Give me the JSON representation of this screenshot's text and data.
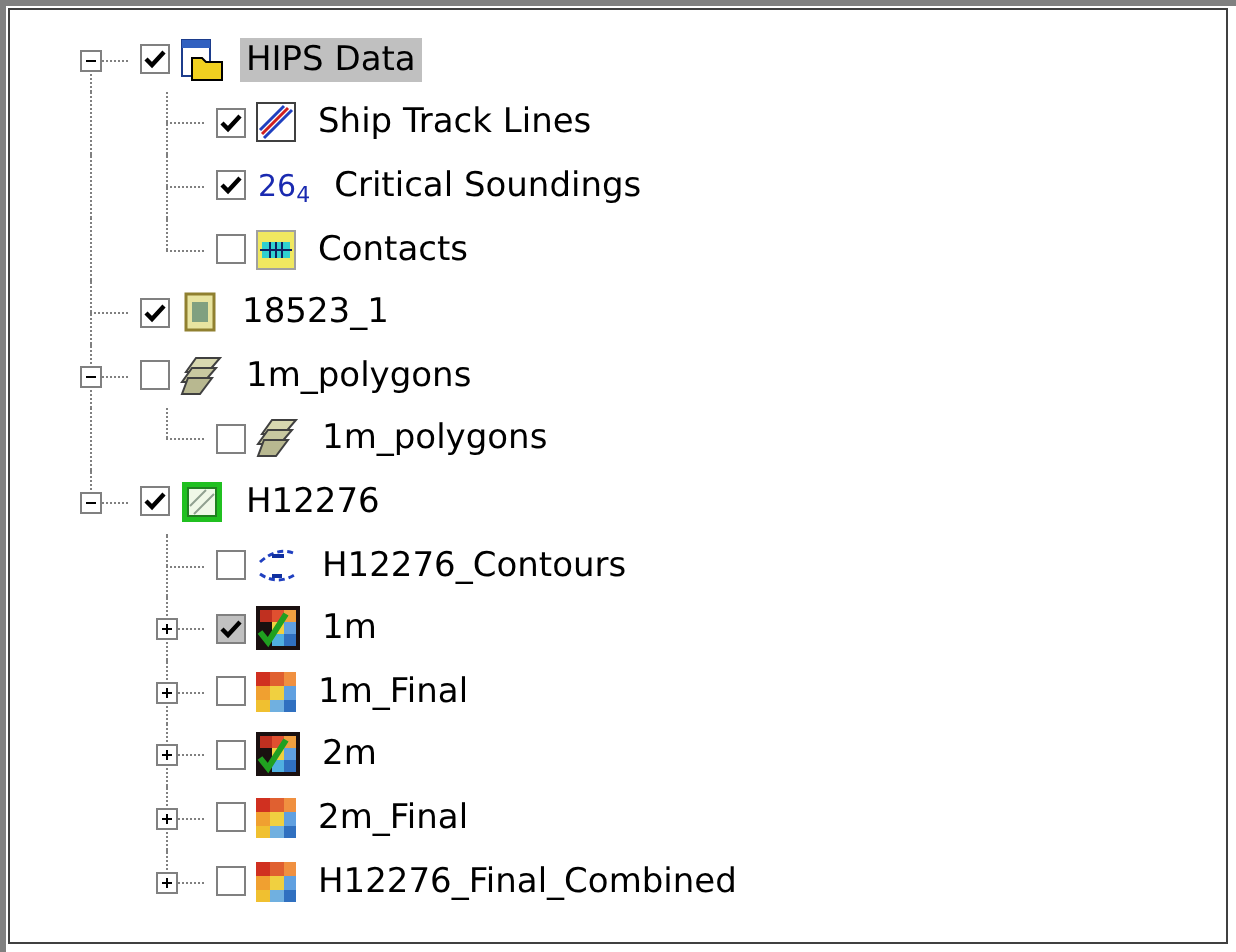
{
  "tree": [
    {
      "label": "HIPS Data",
      "kind": "folder-layer",
      "checked": true,
      "greyed": false,
      "selected": true,
      "expanded": true,
      "children": [
        {
          "label": "Ship Track Lines",
          "kind": "track-lines",
          "checked": true,
          "greyed": false,
          "selected": false
        },
        {
          "label": "Critical Soundings",
          "kind": "soundings",
          "icon_text": "26$_{4}$",
          "checked": true,
          "greyed": false,
          "selected": false
        },
        {
          "label": "Contacts",
          "kind": "contacts",
          "checked": false,
          "greyed": false,
          "selected": false
        }
      ]
    },
    {
      "label": "18523_1",
      "kind": "image",
      "checked": true,
      "greyed": false,
      "selected": false
    },
    {
      "label": "1m_polygons",
      "kind": "polygons",
      "checked": false,
      "greyed": false,
      "selected": false,
      "expanded": true,
      "children": [
        {
          "label": "1m_polygons",
          "kind": "polygons",
          "checked": false,
          "greyed": false,
          "selected": false
        }
      ]
    },
    {
      "label": "H12276",
      "kind": "survey",
      "checked": true,
      "greyed": false,
      "selected": false,
      "expanded": true,
      "children": [
        {
          "label": "H12276_Contours",
          "kind": "contours",
          "checked": false,
          "greyed": false,
          "selected": false
        },
        {
          "label": "1m",
          "kind": "surface-check",
          "checked": true,
          "greyed": true,
          "selected": false,
          "expanded": false
        },
        {
          "label": "1m_Final",
          "kind": "surface-grid",
          "checked": false,
          "greyed": false,
          "selected": false,
          "expanded": false
        },
        {
          "label": "2m",
          "kind": "surface-check",
          "checked": false,
          "greyed": false,
          "selected": false,
          "expanded": false
        },
        {
          "label": "2m_Final",
          "kind": "surface-grid",
          "checked": false,
          "greyed": false,
          "selected": false,
          "expanded": false
        },
        {
          "label": "H12276_Final_Combined",
          "kind": "surface-grid",
          "checked": false,
          "greyed": false,
          "selected": false,
          "expanded": false
        }
      ]
    }
  ]
}
